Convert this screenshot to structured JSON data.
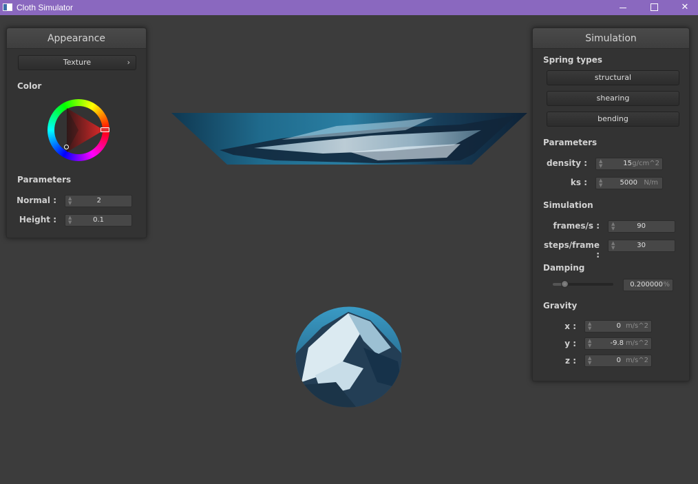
{
  "window": {
    "title": "Cloth Simulator",
    "controls": {
      "minimize": "",
      "maximize": "",
      "close": "✕"
    }
  },
  "appearance": {
    "title": "Appearance",
    "texture_button": "Texture",
    "color_label": "Color",
    "selected_color": "#e23030",
    "parameters_label": "Parameters",
    "normal": {
      "label": "Normal :",
      "value": "2"
    },
    "height": {
      "label": "Height :",
      "value": "0.1"
    }
  },
  "simulation": {
    "title": "Simulation",
    "spring_types_label": "Spring types",
    "spring_types": [
      "structural",
      "shearing",
      "bending"
    ],
    "parameters_label": "Parameters",
    "density": {
      "label": "density :",
      "value": "15",
      "unit": "g/cm^2"
    },
    "ks": {
      "label": "ks :",
      "value": "5000",
      "unit": "N/m"
    },
    "simulation_label": "Simulation",
    "frames_per_second": {
      "label": "frames/s :",
      "value": "90"
    },
    "steps_per_frame": {
      "label": "steps/frame :",
      "value": "30"
    },
    "damping_label": "Damping",
    "damping": {
      "value": "0.200000",
      "unit": "%",
      "slider_fraction": 0.2
    },
    "gravity_label": "Gravity",
    "gravity": [
      {
        "label": "x :",
        "value": "0",
        "unit": "m/s^2"
      },
      {
        "label": "y :",
        "value": "-9.8",
        "unit": "m/s^2"
      },
      {
        "label": "z :",
        "value": "0",
        "unit": "m/s^2"
      }
    ]
  }
}
